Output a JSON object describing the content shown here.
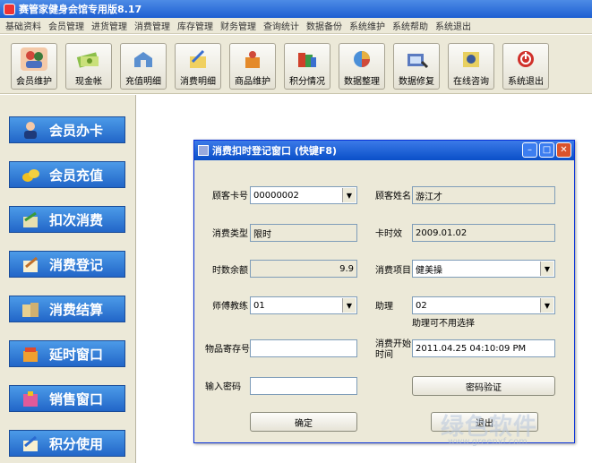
{
  "window": {
    "title": "赛管家健身会馆专用版8.17"
  },
  "menu": [
    "基础资料",
    "会员管理",
    "进货管理",
    "消费管理",
    "库存管理",
    "财务管理",
    "查询统计",
    "数据备份",
    "系统维护",
    "系统帮助",
    "系统退出"
  ],
  "toolbar": [
    {
      "label": "会员维护",
      "icon": "members-icon"
    },
    {
      "label": "现金帐",
      "icon": "cash-icon"
    },
    {
      "label": "充值明细",
      "icon": "recharge-icon"
    },
    {
      "label": "消费明细",
      "icon": "consumption-icon"
    },
    {
      "label": "商品维护",
      "icon": "goods-icon"
    },
    {
      "label": "积分情况",
      "icon": "points-icon"
    },
    {
      "label": "数据整理",
      "icon": "data-icon"
    },
    {
      "label": "数据修复",
      "icon": "repair-icon"
    },
    {
      "label": "在线咨询",
      "icon": "online-icon"
    },
    {
      "label": "系统退出",
      "icon": "exit-icon"
    }
  ],
  "sidebar": [
    {
      "label": "会员办卡",
      "icon": "member-card-icon"
    },
    {
      "label": "会员充值",
      "icon": "coins-icon"
    },
    {
      "label": "扣次消费",
      "icon": "deduct-icon"
    },
    {
      "label": "消费登记",
      "icon": "register-icon"
    },
    {
      "label": "消费结算",
      "icon": "settle-icon"
    },
    {
      "label": "延时窗口",
      "icon": "delay-icon"
    },
    {
      "label": "销售窗口",
      "icon": "sales-icon"
    },
    {
      "label": "积分使用",
      "icon": "points-use-icon"
    }
  ],
  "dialog": {
    "title": "消费扣时登记窗口 (快键F8)",
    "card_no": {
      "label": "顾客卡号",
      "value": "00000002"
    },
    "name": {
      "label": "顾客姓名",
      "value": "游江才"
    },
    "type": {
      "label": "消费类型",
      "value": "限时"
    },
    "expire": {
      "label": "卡时效",
      "value": "2009.01.02"
    },
    "balance": {
      "label": "时数余额",
      "value": "9.9"
    },
    "item": {
      "label": "消费项目",
      "value": "健美操"
    },
    "coach": {
      "label": "师傅教练",
      "value": "01"
    },
    "assistant": {
      "label": "助理",
      "value": "02",
      "note": "助理可不用选择"
    },
    "deposit": {
      "label": "物品寄存号",
      "value": ""
    },
    "start": {
      "label_line1": "消费开始",
      "label_line2": "时间",
      "value": "2011.04.25 04:10:09 PM"
    },
    "password": {
      "label": "输入密码",
      "value": ""
    },
    "verify_button": "密码验证",
    "ok_button": "确定",
    "exit_button": "退出"
  },
  "watermark": {
    "big": "绿色软件",
    "url": "www.greenxf.com"
  }
}
